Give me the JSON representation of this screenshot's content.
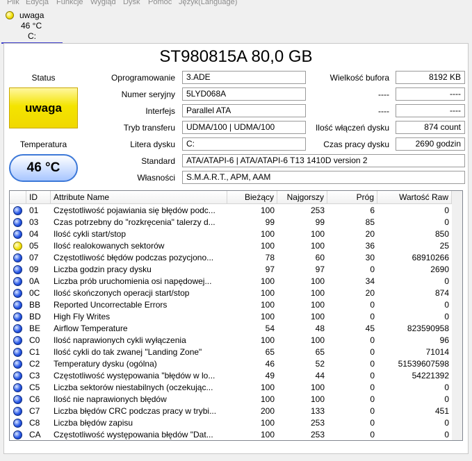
{
  "menu": [
    "Plik",
    "Edycja",
    "Funkcje",
    "Wygląd",
    "Dysk",
    "Pomoc",
    "Język(Language)"
  ],
  "disk_tab": {
    "status": "uwaga",
    "temperature": "46 °C",
    "letter": "C:"
  },
  "model": "ST980815A 80,0 GB",
  "status": {
    "label": "Status",
    "value": "uwaga",
    "color": "#f2e000"
  },
  "temperature": {
    "label": "Temperatura",
    "value": "46 °C",
    "color": "#3c78d8"
  },
  "fields": {
    "firmware": {
      "label": "Oprogramowanie",
      "value": "3.ADE"
    },
    "serial": {
      "label": "Numer seryjny",
      "value": "5LYD068A"
    },
    "interface": {
      "label": "Interfejs",
      "value": "Parallel ATA"
    },
    "transfer": {
      "label": "Tryb transferu",
      "value": "UDMA/100 | UDMA/100"
    },
    "drive_letter": {
      "label": "Litera dysku",
      "value": "C:"
    },
    "standard": {
      "label": "Standard",
      "value": "ATA/ATAPI-6 | ATA/ATAPI-6 T13 1410D version 2"
    },
    "features": {
      "label": "Własności",
      "value": "S.M.A.R.T., APM, AAM"
    },
    "buffer": {
      "label": "Wielkość bufora",
      "value": "8192 KB"
    },
    "blank1": {
      "label": "----",
      "value": "----"
    },
    "blank2": {
      "label": "----",
      "value": "----"
    },
    "power_on_count": {
      "label": "Ilość włączeń dysku",
      "value": "874 count"
    },
    "power_on_hours": {
      "label": "Czas pracy dysku",
      "value": "2690 godzin"
    }
  },
  "table": {
    "columns": [
      "ID",
      "Attribute Name",
      "Bieżący",
      "Najgorszy",
      "Próg",
      "Wartość Raw"
    ],
    "rows": [
      {
        "status": "good",
        "id": "01",
        "name": "Częstotliwość pojawiania się błędów podc...",
        "cur": "100",
        "worst": "253",
        "thr": "6",
        "raw": "0"
      },
      {
        "status": "good",
        "id": "03",
        "name": "Czas potrzebny do \"rozkręcenia\" talerzy d...",
        "cur": "99",
        "worst": "99",
        "thr": "85",
        "raw": "0"
      },
      {
        "status": "good",
        "id": "04",
        "name": "Ilość cykli start/stop",
        "cur": "100",
        "worst": "100",
        "thr": "20",
        "raw": "850"
      },
      {
        "status": "caution",
        "id": "05",
        "name": "Ilość realokowanych sektorów",
        "cur": "100",
        "worst": "100",
        "thr": "36",
        "raw": "25"
      },
      {
        "status": "good",
        "id": "07",
        "name": "Częstotliwość błędów podczas pozycjono...",
        "cur": "78",
        "worst": "60",
        "thr": "30",
        "raw": "68910266"
      },
      {
        "status": "good",
        "id": "09",
        "name": "Liczba godzin pracy dysku",
        "cur": "97",
        "worst": "97",
        "thr": "0",
        "raw": "2690"
      },
      {
        "status": "good",
        "id": "0A",
        "name": "Liczba prób uruchomienia osi napędowej...",
        "cur": "100",
        "worst": "100",
        "thr": "34",
        "raw": "0"
      },
      {
        "status": "good",
        "id": "0C",
        "name": "Ilość skończonych operacji start/stop",
        "cur": "100",
        "worst": "100",
        "thr": "20",
        "raw": "874"
      },
      {
        "status": "good",
        "id": "BB",
        "name": "Reported Uncorrectable Errors",
        "cur": "100",
        "worst": "100",
        "thr": "0",
        "raw": "0"
      },
      {
        "status": "good",
        "id": "BD",
        "name": "High Fly Writes",
        "cur": "100",
        "worst": "100",
        "thr": "0",
        "raw": "0"
      },
      {
        "status": "good",
        "id": "BE",
        "name": "Airflow Temperature",
        "cur": "54",
        "worst": "48",
        "thr": "45",
        "raw": "823590958"
      },
      {
        "status": "good",
        "id": "C0",
        "name": "Ilość naprawionych cykli wyłączenia",
        "cur": "100",
        "worst": "100",
        "thr": "0",
        "raw": "96"
      },
      {
        "status": "good",
        "id": "C1",
        "name": "Ilość cykli do tak zwanej \"Landing Zone\"",
        "cur": "65",
        "worst": "65",
        "thr": "0",
        "raw": "71014"
      },
      {
        "status": "good",
        "id": "C2",
        "name": "Temperatury dysku (ogólna)",
        "cur": "46",
        "worst": "52",
        "thr": "0",
        "raw": "51539607598"
      },
      {
        "status": "good",
        "id": "C3",
        "name": "Częstotliwość występowania \"błędów w lo...",
        "cur": "49",
        "worst": "44",
        "thr": "0",
        "raw": "54221392"
      },
      {
        "status": "good",
        "id": "C5",
        "name": "Liczba sektorów niestabilnych (oczekując...",
        "cur": "100",
        "worst": "100",
        "thr": "0",
        "raw": "0"
      },
      {
        "status": "good",
        "id": "C6",
        "name": "Ilość nie naprawionych błędów",
        "cur": "100",
        "worst": "100",
        "thr": "0",
        "raw": "0"
      },
      {
        "status": "good",
        "id": "C7",
        "name": "Liczba błędów CRC podczas pracy w trybi...",
        "cur": "200",
        "worst": "133",
        "thr": "0",
        "raw": "451"
      },
      {
        "status": "good",
        "id": "C8",
        "name": "Liczba błędów zapisu",
        "cur": "100",
        "worst": "253",
        "thr": "0",
        "raw": "0"
      },
      {
        "status": "good",
        "id": "CA",
        "name": "Częstotliwość występowania błędów \"Dat...",
        "cur": "100",
        "worst": "253",
        "thr": "0",
        "raw": "0"
      }
    ]
  }
}
